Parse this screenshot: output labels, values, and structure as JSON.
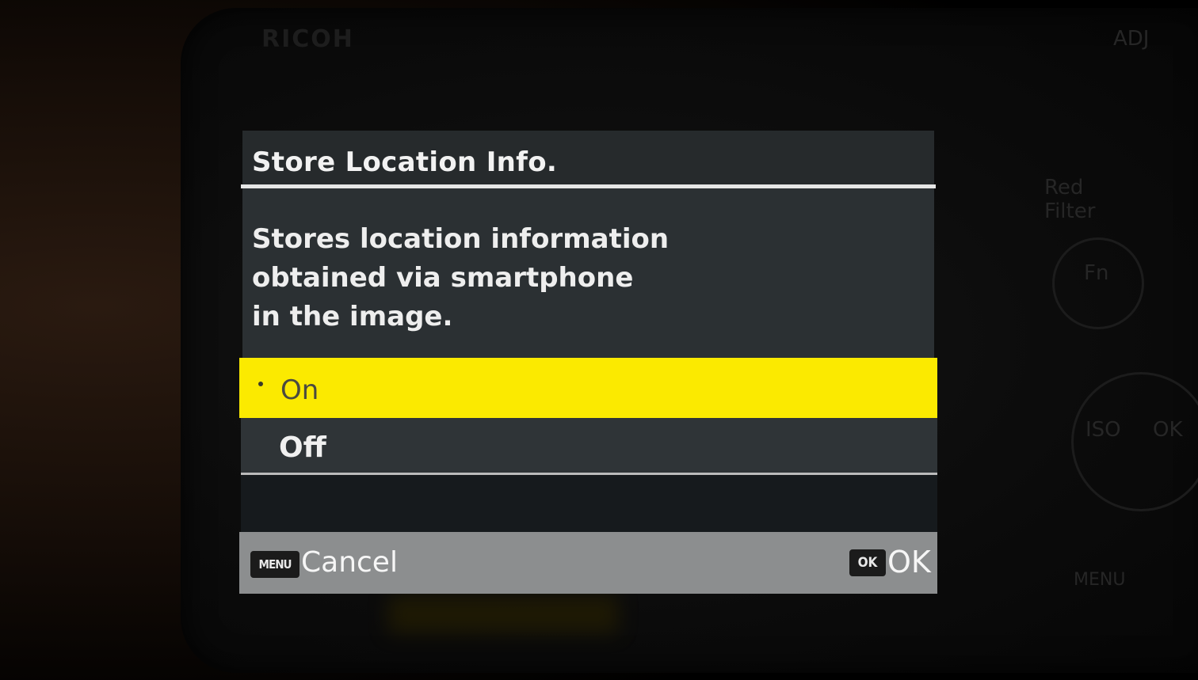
{
  "dialog": {
    "title": "Store Location Info.",
    "description": [
      "Stores location information",
      "obtained via smartphone",
      "in the image."
    ],
    "options": [
      {
        "label": "On",
        "selected": true
      },
      {
        "label": "Off",
        "selected": false
      }
    ],
    "footer": {
      "cancel_key": "MENU",
      "cancel_label": "Cancel",
      "ok_key": "OK",
      "ok_label": "OK"
    }
  },
  "camera": {
    "brand_text": "RICOH",
    "controls": [
      "ADJ",
      "Red Filter",
      "Fn",
      "ISO",
      "OK",
      "MENU"
    ]
  },
  "colors": {
    "highlight": "#fbea00",
    "panel": "#2b3033",
    "footer": "#8c8e8f"
  }
}
